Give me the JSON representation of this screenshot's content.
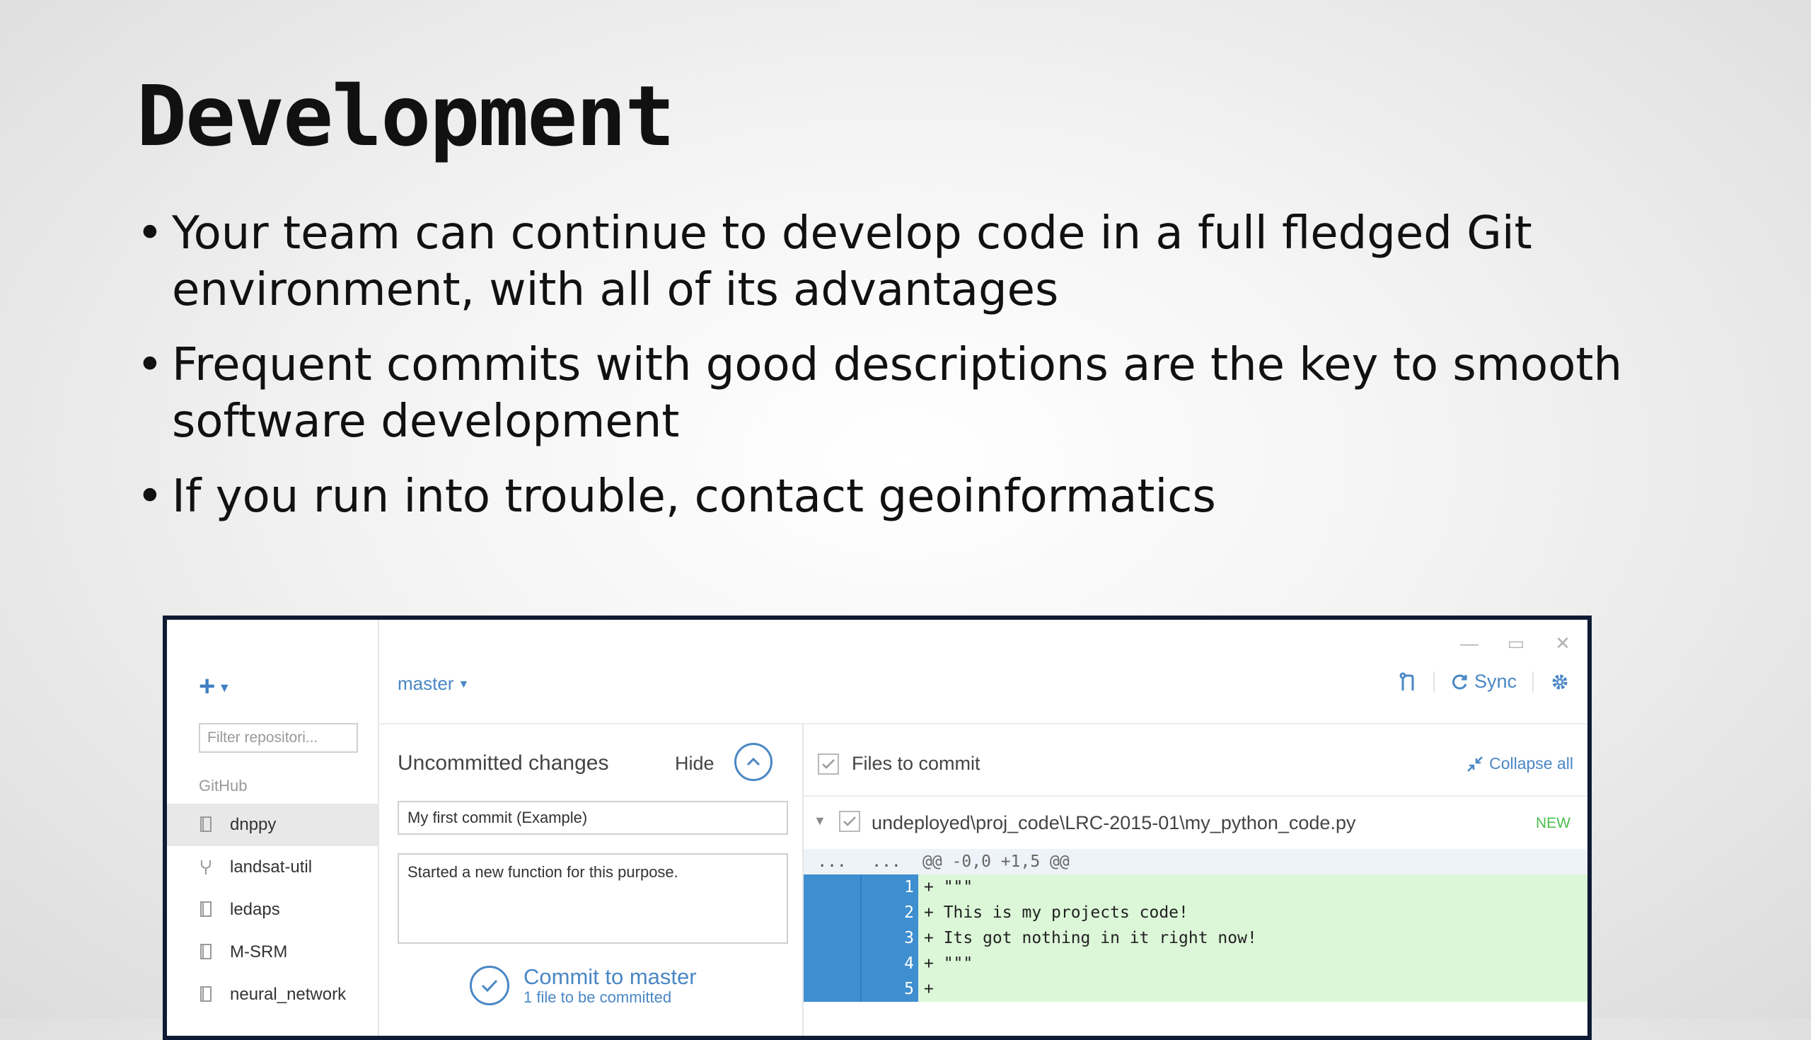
{
  "slide": {
    "title": "Development",
    "bullets": [
      "Your team can continue to develop code in a full fledged Git environment, with all of its advantages",
      "Frequent commits with good descriptions are the key to smooth software development",
      "If you run into trouble, contact geoinformatics"
    ]
  },
  "app": {
    "window_controls": {
      "minimize": "—",
      "maximize": "▭",
      "close": "✕"
    },
    "sidebar": {
      "add_icon": "plus-icon",
      "filter_placeholder": "Filter repositori...",
      "section_label": "GitHub",
      "repos": [
        {
          "name": "dnppy",
          "icon": "repo-icon",
          "selected": true
        },
        {
          "name": "landsat-util",
          "icon": "fork-icon",
          "selected": false
        },
        {
          "name": "ledaps",
          "icon": "repo-icon",
          "selected": false
        },
        {
          "name": "M-SRM",
          "icon": "repo-icon",
          "selected": false
        },
        {
          "name": "neural_network",
          "icon": "repo-icon",
          "selected": false
        }
      ]
    },
    "toolbar": {
      "branch": "master",
      "sync_label": "Sync",
      "icons": [
        "pull-request-icon",
        "sync-icon",
        "gear-icon"
      ]
    },
    "changes": {
      "title": "Uncommitted changes",
      "hide_label": "Hide",
      "summary_value": "My first commit (Example)",
      "description_value": "Started a new function for this purpose.",
      "commit_label": "Commit to master",
      "commit_sub": "1 file to be committed"
    },
    "diff": {
      "files_to_commit_label": "Files to commit",
      "collapse_all_label": "Collapse all",
      "file_path": "undeployed\\proj_code\\LRC-2015-01\\my_python_code.py",
      "file_badge": "NEW",
      "hunk": {
        "left": "...",
        "right": "...",
        "text": "@@ -0,0 +1,5 @@"
      },
      "lines": [
        {
          "num": "1",
          "text": "+ \"\"\""
        },
        {
          "num": "2",
          "text": "+ This is my projects code!"
        },
        {
          "num": "3",
          "text": "+ Its got nothing in it right now!"
        },
        {
          "num": "4",
          "text": "+ \"\"\""
        },
        {
          "num": "5",
          "text": "+"
        }
      ]
    },
    "colors": {
      "accent": "#4a87c5",
      "added_bg": "#dcf7d8",
      "gutter": "#3e8ed0",
      "new_badge": "#4bbf4b",
      "frame": "#0f1b33"
    }
  }
}
